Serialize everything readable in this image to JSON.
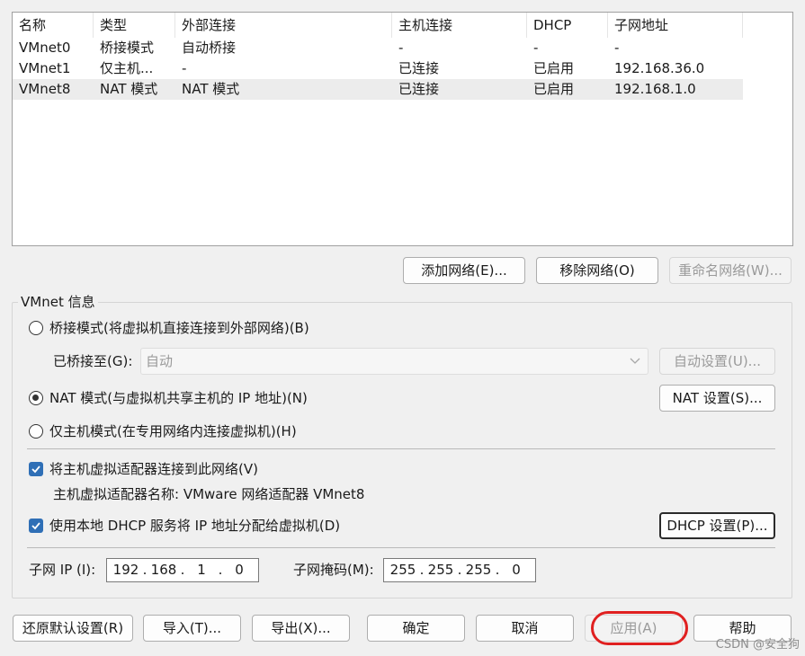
{
  "table": {
    "headers": [
      "名称",
      "类型",
      "外部连接",
      "主机连接",
      "DHCP",
      "子网地址"
    ],
    "rows": [
      [
        "VMnet0",
        "桥接模式",
        "自动桥接",
        "-",
        "-",
        "-"
      ],
      [
        "VMnet1",
        "仅主机...",
        "-",
        "已连接",
        "已启用",
        "192.168.36.0"
      ],
      [
        "VMnet8",
        "NAT 模式",
        "NAT 模式",
        "已连接",
        "已启用",
        "192.168.1.0"
      ]
    ]
  },
  "network_buttons": {
    "add": "添加网络(E)...",
    "remove": "移除网络(O)",
    "rename": "重命名网络(W)..."
  },
  "info": {
    "title": "VMnet 信息",
    "bridged_label": "桥接模式(将虚拟机直接连接到外部网络)(B)",
    "bridged_to_label": "已桥接至(G):",
    "bridged_to_value": "自动",
    "auto_settings": "自动设置(U)...",
    "nat_label": "NAT 模式(与虚拟机共享主机的 IP 地址)(N)",
    "nat_settings": "NAT 设置(S)...",
    "host_only_label": "仅主机模式(在专用网络内连接虚拟机)(H)",
    "selected_mode": "nat",
    "connect_adapter_label": "将主机虚拟适配器连接到此网络(V)",
    "connect_adapter_checked": true,
    "adapter_name_text": "主机虚拟适配器名称: VMware 网络适配器 VMnet8",
    "dhcp_label": "使用本地 DHCP 服务将 IP 地址分配给虚拟机(D)",
    "dhcp_checked": true,
    "dhcp_settings": "DHCP 设置(P)...",
    "subnet_ip_label": "子网 IP (I):",
    "subnet_ip": [
      "192",
      "168",
      "1",
      "0"
    ],
    "subnet_mask_label": "子网掩码(M):",
    "subnet_mask": [
      "255",
      "255",
      "255",
      "0"
    ]
  },
  "footer": {
    "restore": "还原默认设置(R)",
    "import": "导入(T)...",
    "export": "导出(X)...",
    "ok": "确定",
    "cancel": "取消",
    "apply": "应用(A)",
    "help": "帮助"
  },
  "watermark": "CSDN @安全狗",
  "colors": {
    "checkbox": "#2f6fb6",
    "highlight": "#e02020",
    "selected_row": "#ececec"
  }
}
